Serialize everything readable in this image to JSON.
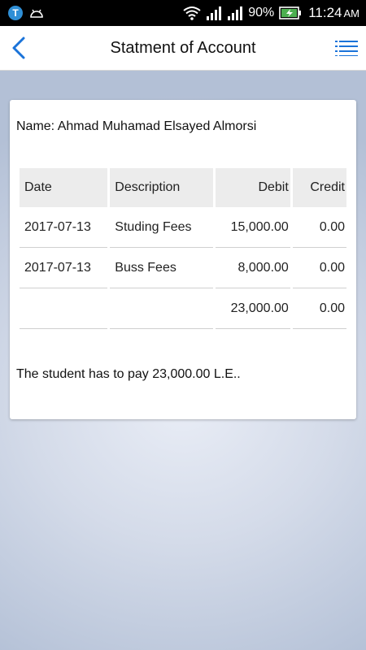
{
  "status_bar": {
    "signal_percent": "90%",
    "time": "11:24",
    "ampm": "AM",
    "left_icons": [
      "t-app-icon",
      "android-debug-icon"
    ],
    "right_icons": [
      "wifi-icon",
      "signal-icon",
      "signal-icon",
      "battery-charging-icon"
    ]
  },
  "app_bar": {
    "title": "Statment of Account",
    "back_icon": "chevron-left-icon",
    "menu_icon": "list-menu-icon",
    "accent_color": "#1a73d9"
  },
  "card": {
    "name_line": "Name: Ahmad Muhamad Elsayed Almorsi",
    "table": {
      "headers": {
        "date": "Date",
        "description": "Description",
        "debit": "Debit",
        "credit": "Credit"
      },
      "rows": [
        {
          "date": "2017-07-13",
          "description": "Studing Fees",
          "debit": "15,000.00",
          "credit": "0.00"
        },
        {
          "date": "2017-07-13",
          "description": "Buss Fees",
          "debit": "8,000.00",
          "credit": "0.00"
        }
      ],
      "totals": {
        "date": "",
        "description": "",
        "debit": "23,000.00",
        "credit": "0.00"
      }
    },
    "summary": "The student has to pay 23,000.00 L.E.."
  }
}
